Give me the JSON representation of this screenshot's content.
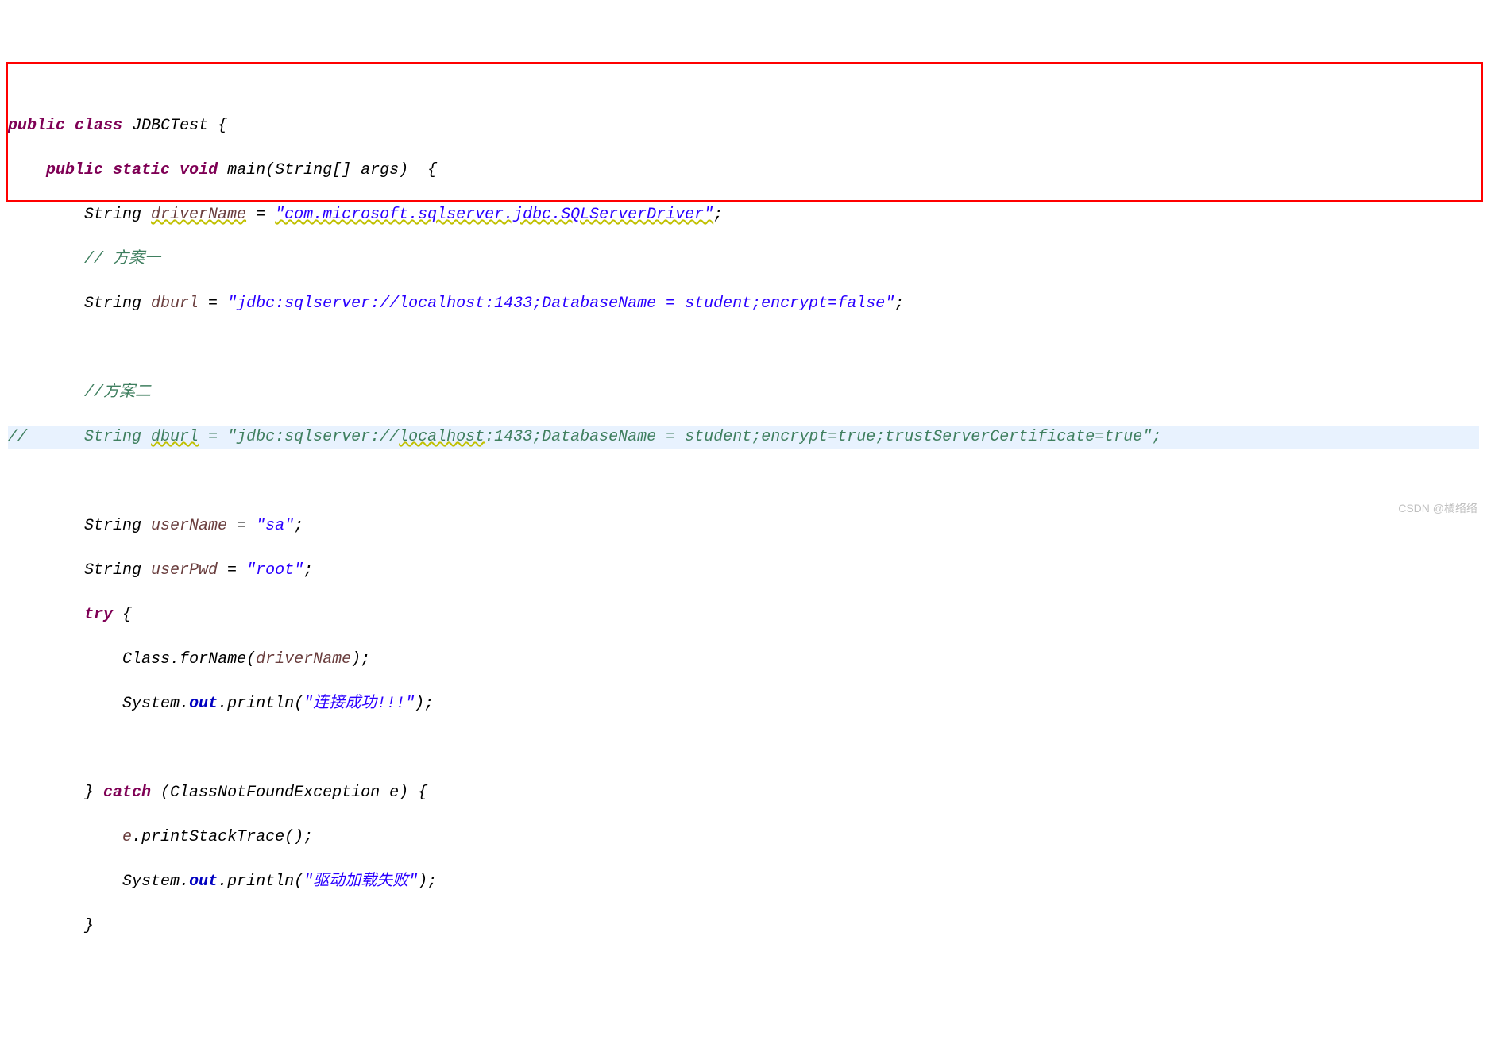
{
  "code": {
    "line1": {
      "public": "public",
      "class": "class",
      "JDBCTest": "JDBCTest",
      "brace": " {"
    },
    "line2": {
      "public": "public",
      "static": "static",
      "void": "void",
      "main": "main",
      "params": "(String[] args)  {"
    },
    "line3": {
      "indent": "        ",
      "type": "String ",
      "var": "driverName",
      "equals": " = ",
      "value": "\"com.microsoft.sqlserver.jdbc.SQLServerDriver\"",
      "semi": ";"
    },
    "line4": {
      "indent": "        ",
      "comment": "// 方案一"
    },
    "line5": {
      "indent": "        ",
      "type": "String ",
      "var": "dburl",
      "equals": " = ",
      "value": "\"jdbc:sqlserver://localhost:1433;DatabaseName = student;encrypt=false\"",
      "semi": ";"
    },
    "line6": "",
    "line7": {
      "indent": "        ",
      "comment": "//方案二"
    },
    "line8": {
      "slash": "//",
      "indent": "      ",
      "type": "String ",
      "var": "dburl",
      "equals": " = \"jdbc:sqlserver://",
      "localhost": "localhost",
      "rest": ":1433;DatabaseName = student;encrypt=true;trustServerCertificate=true\";"
    },
    "line9": "",
    "line10": {
      "indent": "        ",
      "type": "String ",
      "var": "userName",
      "equals": " = ",
      "value": "\"sa\"",
      "semi": ";"
    },
    "line11": {
      "indent": "        ",
      "type": "String ",
      "var": "userPwd",
      "equals": " = ",
      "value": "\"root\"",
      "semi": ";"
    },
    "line12": {
      "indent": "        ",
      "try": "try",
      "brace": " {"
    },
    "line13": {
      "indent": "            ",
      "class": "Class",
      "dot": ".",
      "forName": "forName",
      "open": "(",
      "arg": "driverName",
      "close": ");"
    },
    "line14": {
      "indent": "            ",
      "system": "System",
      "dot1": ".",
      "out": "out",
      "dot2": ".",
      "println": "println",
      "open": "(",
      "value": "\"连接成功!!!\"",
      "close": ");"
    },
    "line15": "",
    "line16": {
      "indent": "        ",
      "brace": "} ",
      "catch": "catch",
      "params": " (ClassNotFoundException e) {"
    },
    "line17": {
      "indent": "            ",
      "e": "e",
      "dot": ".",
      "method": "printStackTrace",
      "call": "();"
    },
    "line18": {
      "indent": "            ",
      "system": "System",
      "dot1": ".",
      "out": "out",
      "dot2": ".",
      "println": "println",
      "open": "(",
      "value": "\"驱动加载失败\"",
      "close": ");"
    },
    "line19": {
      "indent": "        ",
      "brace": "}"
    }
  },
  "watermark": "CSDN @橘络络"
}
